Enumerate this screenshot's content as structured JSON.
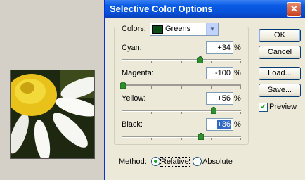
{
  "dialog": {
    "title": "Selective Color Options",
    "close_symbol": "✕"
  },
  "colors": {
    "label": "Colors:",
    "selected": "Greens"
  },
  "sliders": [
    {
      "label": "Cyan:",
      "value": "+34",
      "unit": "%"
    },
    {
      "label": "Magenta:",
      "value": "-100",
      "unit": "%"
    },
    {
      "label": "Yellow:",
      "value": "+56",
      "unit": "%"
    },
    {
      "label": "Black:",
      "value": "+36",
      "unit": "%"
    }
  ],
  "buttons": {
    "ok": "OK",
    "cancel": "Cancel",
    "load": "Load...",
    "save": "Save..."
  },
  "preview": {
    "label": "Preview",
    "checked": true
  },
  "method": {
    "label": "Method:",
    "relative": "Relative",
    "absolute": "Absolute",
    "selected": "relative"
  }
}
